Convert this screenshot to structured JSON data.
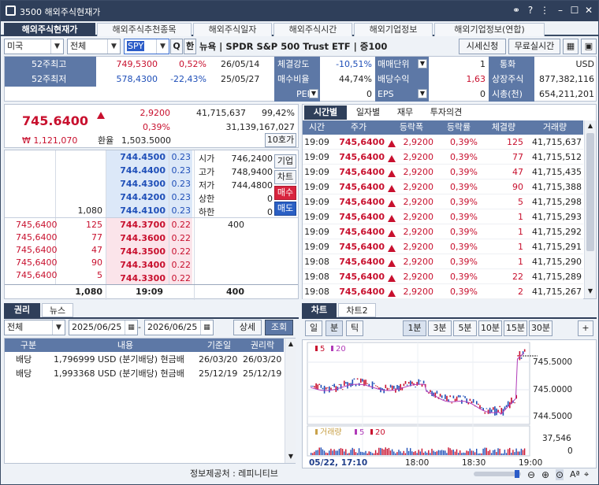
{
  "window": {
    "title": "3500 해외주식현재가"
  },
  "menu_tabs": [
    "해외주식현재가",
    "해외주식추천종목",
    "해외주식일자",
    "해외주식시간",
    "해외기업정보",
    "해외기업정보(연합)"
  ],
  "toolbar": {
    "country": "미국",
    "market": "전체",
    "symbol": "SPY",
    "search_icon": "Q",
    "han_btn": "한",
    "name": "뉴욕 | SPDR S&P 500 Trust ETF | 증100",
    "quote_btn": "시세신청",
    "free_btn": "무료실시간"
  },
  "info": {
    "w52_high_label": "52주최고",
    "w52_high": "749,5300",
    "w52_high_pct": "0,52%",
    "w52_high_date": "26/05/14",
    "w52_low_label": "52주최저",
    "w52_low": "578,4300",
    "w52_low_pct": "-22,43%",
    "w52_low_date": "25/05/27",
    "strength_label": "체결강도",
    "strength": "-10,51%",
    "rate_label": "매수비율",
    "rate": "44,74%",
    "per_label": "PER",
    "per": "0",
    "unit_label": "매매단위",
    "unit": "1",
    "div_label": "배당수익",
    "div": "1,63",
    "eps_label": "EPS",
    "eps": "0",
    "cur_label": "통화",
    "cur": "USD",
    "shares_label": "상장주식",
    "shares": "877,382,116",
    "mcap_label": "시총(천)",
    "mcap": "654,211,201"
  },
  "price": {
    "current": "745.6400",
    "change": "2,9200",
    "change_pct": "0,39%",
    "volume": "41,715,637",
    "vol_ratio": "99,42%",
    "krw": "₩ 1,121,070",
    "fx_label": "환율",
    "fx": "1,503.5000",
    "amount": "31,139,167,027",
    "hoga_btn": "10호가"
  },
  "orderbook": {
    "asks": [
      {
        "price": "744.4500",
        "pct": "0.23"
      },
      {
        "price": "744.4400",
        "pct": "0.23"
      },
      {
        "price": "744.4300",
        "pct": "0.23"
      },
      {
        "price": "744.4200",
        "pct": "0.23"
      },
      {
        "price": "744.4100",
        "pct": "0.23",
        "qty": "1,080"
      }
    ],
    "bids": [
      {
        "price": "744.3700",
        "pct": "0.22",
        "qty": "400"
      },
      {
        "price": "744.3600",
        "pct": "0.22"
      },
      {
        "price": "744.3500",
        "pct": "0.22"
      },
      {
        "price": "744.3400",
        "pct": "0.22"
      },
      {
        "price": "744.3300",
        "pct": "0.22"
      }
    ],
    "stats": [
      {
        "label": "시가",
        "value": "746,2400"
      },
      {
        "label": "고가",
        "value": "748,9400"
      },
      {
        "label": "저가",
        "value": "744,4800"
      },
      {
        "label": "상한",
        "value": "0"
      },
      {
        "label": "하한",
        "value": "0"
      }
    ],
    "side_btns": [
      "기업",
      "차트",
      "매수",
      "매도"
    ],
    "trades": [
      {
        "price": "745,6400",
        "qty": "125"
      },
      {
        "price": "745,6400",
        "qty": "77"
      },
      {
        "price": "745,6400",
        "qty": "47"
      },
      {
        "price": "745,6400",
        "qty": "90"
      },
      {
        "price": "745,6400",
        "qty": "5"
      }
    ],
    "total_ask": "1,080",
    "time": "19:09",
    "total_bid": "400"
  },
  "right_tabs": [
    "시간별",
    "일자별",
    "재무",
    "투자의견"
  ],
  "ticks_header": [
    "시간",
    "주가",
    "등락폭",
    "등락률",
    "체결량",
    "거래량"
  ],
  "ticks": [
    {
      "time": "19:09",
      "price": "745,6400",
      "chg": "2,9200",
      "pct": "0,39%",
      "qty": "125",
      "vol": "41,715,637"
    },
    {
      "time": "19:09",
      "price": "745,6400",
      "chg": "2,9200",
      "pct": "0,39%",
      "qty": "77",
      "vol": "41,715,512"
    },
    {
      "time": "19:09",
      "price": "745,6400",
      "chg": "2,9200",
      "pct": "0,39%",
      "qty": "47",
      "vol": "41,715,435"
    },
    {
      "time": "19:09",
      "price": "745,6400",
      "chg": "2,9200",
      "pct": "0,39%",
      "qty": "90",
      "vol": "41,715,388"
    },
    {
      "time": "19:09",
      "price": "745,6400",
      "chg": "2,9200",
      "pct": "0,39%",
      "qty": "5",
      "vol": "41,715,298"
    },
    {
      "time": "19:09",
      "price": "745,6400",
      "chg": "2,9200",
      "pct": "0,39%",
      "qty": "1",
      "vol": "41,715,293"
    },
    {
      "time": "19:09",
      "price": "745,6400",
      "chg": "2,9200",
      "pct": "0,39%",
      "qty": "1",
      "vol": "41,715,292"
    },
    {
      "time": "19:09",
      "price": "745,6400",
      "chg": "2,9200",
      "pct": "0,39%",
      "qty": "1",
      "vol": "41,715,291"
    },
    {
      "time": "19:08",
      "price": "745,6400",
      "chg": "2,9200",
      "pct": "0,39%",
      "qty": "1",
      "vol": "41,715,290"
    },
    {
      "time": "19:08",
      "price": "745,6400",
      "chg": "2,9200",
      "pct": "0,39%",
      "qty": "22",
      "vol": "41,715,289"
    },
    {
      "time": "19:08",
      "price": "745,6400",
      "chg": "2,9200",
      "pct": "0,39%",
      "qty": "2",
      "vol": "41,715,267"
    }
  ],
  "rights": {
    "tabs": [
      "권리",
      "뉴스"
    ],
    "filter": "전체",
    "from": "2025/06/25",
    "to": "2026/06/25",
    "detail_btn": "상세",
    "search_btn": "조회",
    "header": [
      "구분",
      "내용",
      "기준일",
      "권리락"
    ],
    "rows": [
      {
        "type": "배당",
        "content": "1,796999 USD (분기배당) 현금배",
        "base": "26/03/20",
        "ex": "26/03/20"
      },
      {
        "type": "배당",
        "content": "1,993368 USD (분기배당) 현금배",
        "base": "25/12/19",
        "ex": "25/12/19"
      }
    ],
    "source": "정보제공처 : 레피니티브"
  },
  "chart": {
    "tabs": [
      "차트",
      "차트2"
    ],
    "periods": [
      "일",
      "분",
      "틱"
    ],
    "intervals": [
      "1분",
      "3분",
      "5분",
      "10분",
      "15분",
      "30분"
    ],
    "plus": "+",
    "legend_ma": [
      "5",
      "20"
    ],
    "vol_legend": [
      "거래량",
      "5",
      "20"
    ],
    "y_labels": [
      "745.5000",
      "745.0000",
      "744.5000"
    ],
    "vol_labels": [
      "37,546",
      "0"
    ],
    "x_labels": [
      "05/22, 17:10",
      "18:00",
      "18:30",
      "19:00"
    ]
  },
  "colors": {
    "accent": "#2f3f5a",
    "up": "#c8102e",
    "down": "#1f4fb8",
    "header": "#5d78a6"
  }
}
